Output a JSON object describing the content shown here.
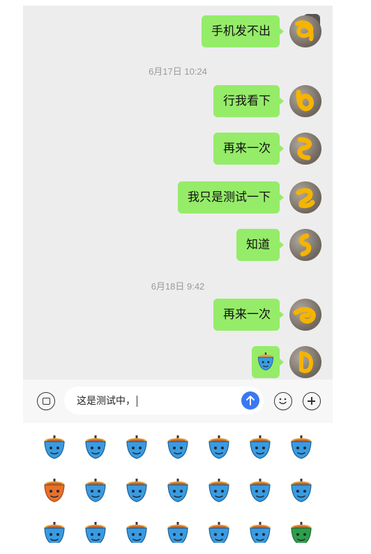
{
  "messages": [
    {
      "kind": "text",
      "text": "手机发不出"
    },
    {
      "kind": "timestamp",
      "text": "6月17日 10:24"
    },
    {
      "kind": "text",
      "text": "行我看下"
    },
    {
      "kind": "text",
      "text": "再来一次"
    },
    {
      "kind": "text",
      "text": "我只是测试一下"
    },
    {
      "kind": "text",
      "text": "知道"
    },
    {
      "kind": "timestamp",
      "text": "6月18日 9:42"
    },
    {
      "kind": "text",
      "text": "再来一次"
    },
    {
      "kind": "emoji",
      "icon": "blue-face-emoji"
    }
  ],
  "input": {
    "value": "这是测试中，"
  },
  "icons": {
    "voice": "voice-icon",
    "send": "send-up-arrow-icon",
    "emoji": "smile-icon",
    "more": "plus-icon",
    "expand": "expand-icon"
  },
  "colors": {
    "bubble": "#95ec69",
    "chat_bg": "#ededed",
    "send": "#3a78f2",
    "emoji_blue": "#3a9be0",
    "emoji_orange": "#e8702a",
    "emoji_green": "#2f9e48",
    "scribble": "#f5b400"
  },
  "emoji_panel": {
    "rows": [
      [
        "blue-face",
        "blue-face-question",
        "blue-face-spiral",
        "blue-face-mask",
        "blue-face-crying",
        "blue-face-smile",
        "blue-face-dizzy"
      ],
      [
        "orange-face-angry",
        "blue-face-squint",
        "blue-face-blush",
        "blue-face-grin",
        "blue-face-teeth",
        "blue-face-tongue",
        "blue-face-tears"
      ],
      [
        "blue-face-sleepy",
        "blue-face-goggle",
        "blue-face-frown",
        "blue-face-laugh",
        "blue-face-shocked",
        "blue-face-grimace",
        "green-face-sick"
      ]
    ]
  }
}
